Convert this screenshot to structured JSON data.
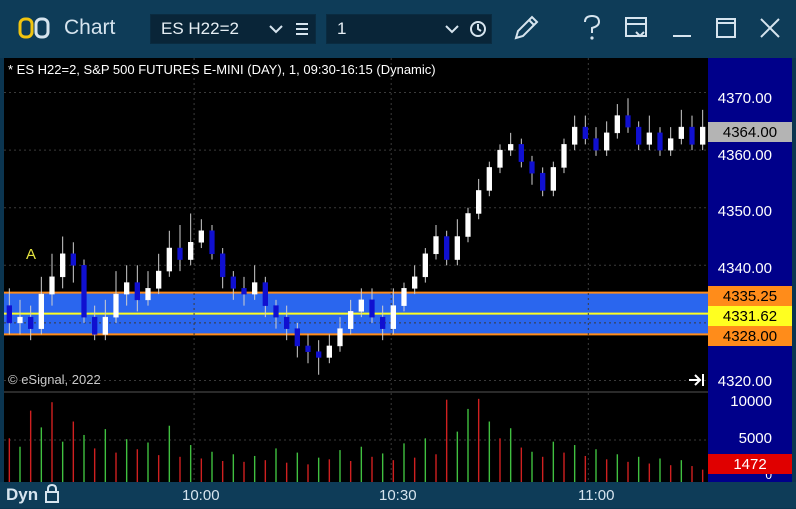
{
  "app": {
    "title": "Chart"
  },
  "toolbar": {
    "symbol": "ES H22=2",
    "interval": "1",
    "icons": [
      "link-toggle-icon",
      "chevron-down-icon",
      "list-icon",
      "clock-icon",
      "pencil-icon",
      "help-icon",
      "page-settings-icon",
      "minimize-icon",
      "maximize-icon",
      "close-icon"
    ]
  },
  "chart_header": "* ES H22=2, S&P 500 FUTURES E-MINI (DAY), 1, 09:30-16:15 (Dynamic)",
  "annotation_label": "A",
  "copyright": "© eSignal, 2022",
  "price_axis": {
    "labels": [
      "4370.00",
      "4360.00",
      "4350.00",
      "4340.00",
      "4320.00"
    ],
    "values": [
      4370,
      4360,
      4350,
      4340,
      4320
    ]
  },
  "price_tags": {
    "last": {
      "label": "4364.00",
      "value": 4364.0,
      "color": "#b4b4b4"
    },
    "upper": {
      "label": "4335.25",
      "value": 4335.25,
      "color": "#ff8c1a"
    },
    "mid": {
      "label": "4331.62",
      "value": 4331.62,
      "color": "#ffff20"
    },
    "lower": {
      "label": "4328.00",
      "value": 4328.0,
      "color": "#ff8c1a"
    }
  },
  "volume_axis": {
    "labels": [
      "10000",
      "5000",
      "0"
    ],
    "values": [
      10000,
      5000,
      0
    ],
    "last_label": "1472",
    "last_value": 1472,
    "last_color": "#e00000"
  },
  "time_axis": {
    "labels": [
      "10:00",
      "10:30",
      "11:00"
    ]
  },
  "bottom": {
    "label": "Dyn"
  },
  "colors": {
    "up_candle": "#ffffff",
    "down_candle": "#1010d0",
    "band_fill": "#2a66ee",
    "band_edge": "#ff8c1a",
    "mid_line": "#ffff20",
    "grid": "#3a3a3a",
    "vol_up": "#40c040",
    "vol_down": "#d02020"
  },
  "chart_data": {
    "type": "candlestick",
    "y_range": [
      4318,
      4376
    ],
    "band": {
      "upper": 4335.25,
      "mid": 4331.62,
      "lower": 4328.0
    },
    "candles": [
      [
        4333,
        4330,
        4336,
        4328
      ],
      [
        4330,
        4331,
        4334,
        4328
      ],
      [
        4331,
        4329,
        4333,
        4327
      ],
      [
        4329,
        4335,
        4338,
        4328
      ],
      [
        4335,
        4338,
        4342,
        4333
      ],
      [
        4338,
        4342,
        4345,
        4336
      ],
      [
        4342,
        4340,
        4344,
        4337
      ],
      [
        4340,
        4331,
        4341,
        4330
      ],
      [
        4331,
        4328,
        4333,
        4327
      ],
      [
        4328,
        4331,
        4334,
        4327
      ],
      [
        4331,
        4335,
        4339,
        4330
      ],
      [
        4335,
        4337,
        4340,
        4333
      ],
      [
        4337,
        4334,
        4340,
        4332
      ],
      [
        4334,
        4336,
        4339,
        4333
      ],
      [
        4336,
        4339,
        4342,
        4335
      ],
      [
        4339,
        4343,
        4346,
        4338
      ],
      [
        4343,
        4341,
        4347,
        4339
      ],
      [
        4341,
        4344,
        4349,
        4340
      ],
      [
        4344,
        4346,
        4348,
        4343
      ],
      [
        4346,
        4342,
        4347,
        4341
      ],
      [
        4342,
        4338,
        4343,
        4336
      ],
      [
        4338,
        4336,
        4339,
        4334
      ],
      [
        4336,
        4335,
        4338,
        4333
      ],
      [
        4335,
        4337,
        4340,
        4334
      ],
      [
        4337,
        4333,
        4338,
        4331
      ],
      [
        4333,
        4331,
        4334,
        4329
      ],
      [
        4331,
        4329,
        4333,
        4327
      ],
      [
        4329,
        4326,
        4330,
        4324
      ],
      [
        4326,
        4325,
        4328,
        4323
      ],
      [
        4325,
        4324,
        4327,
        4321
      ],
      [
        4324,
        4326,
        4328,
        4323
      ],
      [
        4326,
        4329,
        4331,
        4325
      ],
      [
        4329,
        4332,
        4334,
        4328
      ],
      [
        4332,
        4334,
        4336,
        4331
      ],
      [
        4334,
        4331,
        4336,
        4330
      ],
      [
        4331,
        4329,
        4333,
        4327
      ],
      [
        4329,
        4333,
        4336,
        4328
      ],
      [
        4333,
        4336,
        4337,
        4332
      ],
      [
        4336,
        4338,
        4340,
        4335
      ],
      [
        4338,
        4342,
        4343,
        4337
      ],
      [
        4342,
        4345,
        4347,
        4341
      ],
      [
        4345,
        4341,
        4346,
        4340
      ],
      [
        4341,
        4345,
        4348,
        4340
      ],
      [
        4345,
        4349,
        4350,
        4344
      ],
      [
        4349,
        4353,
        4355,
        4348
      ],
      [
        4353,
        4357,
        4358,
        4352
      ],
      [
        4357,
        4360,
        4361,
        4356
      ],
      [
        4360,
        4361,
        4363,
        4359
      ],
      [
        4361,
        4358,
        4362,
        4357
      ],
      [
        4358,
        4356,
        4359,
        4354
      ],
      [
        4356,
        4353,
        4357,
        4352
      ],
      [
        4353,
        4357,
        4358,
        4352
      ],
      [
        4357,
        4361,
        4362,
        4356
      ],
      [
        4361,
        4364,
        4366,
        4360
      ],
      [
        4364,
        4362,
        4366,
        4361
      ],
      [
        4362,
        4360,
        4364,
        4359
      ],
      [
        4360,
        4363,
        4365,
        4359
      ],
      [
        4363,
        4366,
        4368,
        4362
      ],
      [
        4366,
        4364,
        4369,
        4363
      ],
      [
        4364,
        4361,
        4365,
        4360
      ],
      [
        4361,
        4363,
        4366,
        4360
      ],
      [
        4363,
        4360,
        4364,
        4359
      ],
      [
        4360,
        4362,
        4364,
        4359
      ],
      [
        4362,
        4364,
        4367,
        4361
      ],
      [
        4364,
        4361,
        4366,
        4360
      ],
      [
        4361,
        4364,
        4367,
        4360
      ]
    ],
    "volume": [
      {
        "v": 5200,
        "up": false
      },
      {
        "v": 4200,
        "up": true
      },
      {
        "v": 8500,
        "up": false
      },
      {
        "v": 6500,
        "up": true
      },
      {
        "v": 9500,
        "up": false
      },
      {
        "v": 4800,
        "up": true
      },
      {
        "v": 7200,
        "up": false
      },
      {
        "v": 5600,
        "up": true
      },
      {
        "v": 4000,
        "up": false
      },
      {
        "v": 6300,
        "up": true
      },
      {
        "v": 3500,
        "up": false
      },
      {
        "v": 5100,
        "up": true
      },
      {
        "v": 3900,
        "up": false
      },
      {
        "v": 4700,
        "up": true
      },
      {
        "v": 3200,
        "up": false
      },
      {
        "v": 6700,
        "up": true
      },
      {
        "v": 3000,
        "up": false
      },
      {
        "v": 4400,
        "up": true
      },
      {
        "v": 2800,
        "up": false
      },
      {
        "v": 3600,
        "up": true
      },
      {
        "v": 2500,
        "up": false
      },
      {
        "v": 3300,
        "up": true
      },
      {
        "v": 2400,
        "up": false
      },
      {
        "v": 3100,
        "up": true
      },
      {
        "v": 2600,
        "up": false
      },
      {
        "v": 4000,
        "up": true
      },
      {
        "v": 2300,
        "up": false
      },
      {
        "v": 3500,
        "up": true
      },
      {
        "v": 2100,
        "up": false
      },
      {
        "v": 2900,
        "up": true
      },
      {
        "v": 2700,
        "up": false
      },
      {
        "v": 3800,
        "up": true
      },
      {
        "v": 2500,
        "up": false
      },
      {
        "v": 4200,
        "up": true
      },
      {
        "v": 3000,
        "up": false
      },
      {
        "v": 3400,
        "up": true
      },
      {
        "v": 2600,
        "up": false
      },
      {
        "v": 4600,
        "up": true
      },
      {
        "v": 2900,
        "up": false
      },
      {
        "v": 5200,
        "up": true
      },
      {
        "v": 3300,
        "up": false
      },
      {
        "v": 9800,
        "up": false
      },
      {
        "v": 6000,
        "up": true
      },
      {
        "v": 8700,
        "up": true
      },
      {
        "v": 9900,
        "up": false
      },
      {
        "v": 7200,
        "up": true
      },
      {
        "v": 5200,
        "up": false
      },
      {
        "v": 6400,
        "up": true
      },
      {
        "v": 4100,
        "up": false
      },
      {
        "v": 3600,
        "up": true
      },
      {
        "v": 3000,
        "up": false
      },
      {
        "v": 4800,
        "up": true
      },
      {
        "v": 3500,
        "up": false
      },
      {
        "v": 4400,
        "up": true
      },
      {
        "v": 3100,
        "up": false
      },
      {
        "v": 3900,
        "up": true
      },
      {
        "v": 2700,
        "up": false
      },
      {
        "v": 3300,
        "up": true
      },
      {
        "v": 2400,
        "up": false
      },
      {
        "v": 3000,
        "up": true
      },
      {
        "v": 2200,
        "up": false
      },
      {
        "v": 2800,
        "up": true
      },
      {
        "v": 2000,
        "up": false
      },
      {
        "v": 2600,
        "up": true
      },
      {
        "v": 1900,
        "up": false
      },
      {
        "v": 1472,
        "up": false
      }
    ]
  }
}
